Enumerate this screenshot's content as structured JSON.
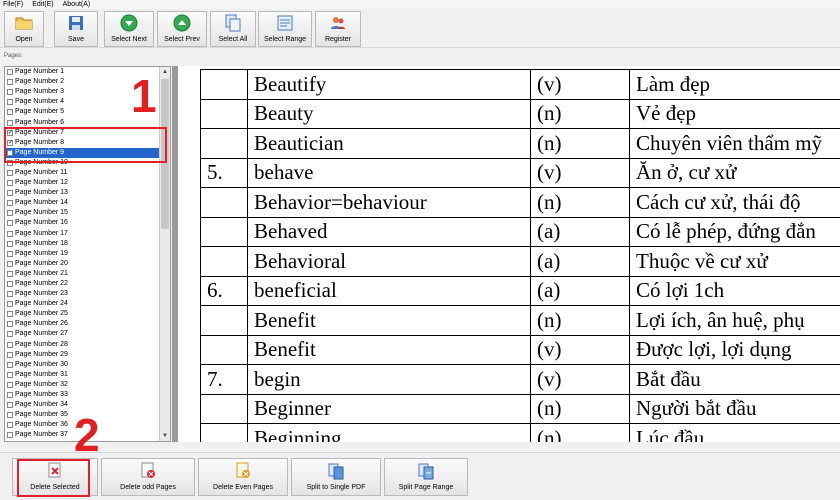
{
  "menu": {
    "file": "File(F)",
    "edit": "Edit(E)",
    "about": "About(A)"
  },
  "toolbar": {
    "open": "Open",
    "save": "Save",
    "select_next": "Select Next",
    "select_prev": "Select Prev",
    "select_all": "Select All",
    "select_range": "Select Range",
    "register": "Register"
  },
  "pages_label": "Pages:",
  "pages": [
    {
      "label": "Page Number 1",
      "checked": false,
      "selected": false
    },
    {
      "label": "Page Number 2",
      "checked": false,
      "selected": false
    },
    {
      "label": "Page Number 3",
      "checked": false,
      "selected": false
    },
    {
      "label": "Page Number 4",
      "checked": false,
      "selected": false
    },
    {
      "label": "Page Number 5",
      "checked": false,
      "selected": false
    },
    {
      "label": "Page Number 6",
      "checked": false,
      "selected": false
    },
    {
      "label": "Page Number 7",
      "checked": true,
      "selected": false
    },
    {
      "label": "Page Number 8",
      "checked": true,
      "selected": false
    },
    {
      "label": "Page Number 9",
      "checked": true,
      "selected": true
    },
    {
      "label": "Page Number 10",
      "checked": false,
      "selected": false
    },
    {
      "label": "Page Number 11",
      "checked": false,
      "selected": false
    },
    {
      "label": "Page Number 12",
      "checked": false,
      "selected": false
    },
    {
      "label": "Page Number 13",
      "checked": false,
      "selected": false
    },
    {
      "label": "Page Number 14",
      "checked": false,
      "selected": false
    },
    {
      "label": "Page Number 15",
      "checked": false,
      "selected": false
    },
    {
      "label": "Page Number 16",
      "checked": false,
      "selected": false
    },
    {
      "label": "Page Number 17",
      "checked": false,
      "selected": false
    },
    {
      "label": "Page Number 18",
      "checked": false,
      "selected": false
    },
    {
      "label": "Page Number 19",
      "checked": false,
      "selected": false
    },
    {
      "label": "Page Number 20",
      "checked": false,
      "selected": false
    },
    {
      "label": "Page Number 21",
      "checked": false,
      "selected": false
    },
    {
      "label": "Page Number 22",
      "checked": false,
      "selected": false
    },
    {
      "label": "Page Number 23",
      "checked": false,
      "selected": false
    },
    {
      "label": "Page Number 24",
      "checked": false,
      "selected": false
    },
    {
      "label": "Page Number 25",
      "checked": false,
      "selected": false
    },
    {
      "label": "Page Number 26",
      "checked": false,
      "selected": false
    },
    {
      "label": "Page Number 27",
      "checked": false,
      "selected": false
    },
    {
      "label": "Page Number 28",
      "checked": false,
      "selected": false
    },
    {
      "label": "Page Number 29",
      "checked": false,
      "selected": false
    },
    {
      "label": "Page Number 30",
      "checked": false,
      "selected": false
    },
    {
      "label": "Page Number 31",
      "checked": false,
      "selected": false
    },
    {
      "label": "Page Number 32",
      "checked": false,
      "selected": false
    },
    {
      "label": "Page Number 33",
      "checked": false,
      "selected": false
    },
    {
      "label": "Page Number 34",
      "checked": false,
      "selected": false
    },
    {
      "label": "Page Number 35",
      "checked": false,
      "selected": false
    },
    {
      "label": "Page Number 36",
      "checked": false,
      "selected": false
    },
    {
      "label": "Page Number 37",
      "checked": false,
      "selected": false
    }
  ],
  "callouts": {
    "one": "1",
    "two": "2"
  },
  "colors": {
    "selection": "#2266cc",
    "callout_red": "#e02020"
  },
  "vocab": [
    {
      "num": "",
      "word": "Beautify",
      "pos": "(v)",
      "meaning": "Làm đẹp"
    },
    {
      "num": "",
      "word": "Beauty",
      "pos": "(n)",
      "meaning": "Vẻ đẹp"
    },
    {
      "num": "",
      "word": "Beautician",
      "pos": "(n)",
      "meaning": "Chuyên viên  thẩm mỹ"
    },
    {
      "num": "5.",
      "word": "behave",
      "pos": "(v)",
      "meaning": "Ăn ở, cư xử"
    },
    {
      "num": "",
      "word": "Behavior=behaviour",
      "pos": "(n)",
      "meaning": "Cách cư xử, thái độ"
    },
    {
      "num": "",
      "word": "Behaved",
      "pos": "(a)",
      "meaning": "Có lễ phép, đứng đắn"
    },
    {
      "num": "",
      "word": "Behavioral",
      "pos": "(a)",
      "meaning": "Thuộc về cư xử"
    },
    {
      "num": "6.",
      "word": "beneficial",
      "pos": "(a)",
      "meaning": "Có lợi 1ch"
    },
    {
      "num": "",
      "word": "Benefit",
      "pos": "(n)",
      "meaning": "Lợi ích, ân huệ, phụ"
    },
    {
      "num": "",
      "word": "Benefit",
      "pos": "(v)",
      "meaning": "Được lợi, lợi dụng"
    },
    {
      "num": "7.",
      "word": "begin",
      "pos": "(v)",
      "meaning": "Bắt đầu"
    },
    {
      "num": "",
      "word": "Beginner",
      "pos": "(n)",
      "meaning": "Người bắt đầu"
    },
    {
      "num": "",
      "word": "Beginning",
      "pos": "(n)",
      "meaning": "Lúc đầu"
    }
  ],
  "bottom": {
    "delete_selected": "Delete Selected",
    "delete_odd": "Delete odd Pages",
    "delete_even": "Delete Even Pages",
    "split_single": "Split to Single PDF",
    "split_range": "Split Page Range"
  },
  "icons": {
    "open": "folder-icon",
    "save": "disk-icon",
    "select_next": "green-down-arrow-icon",
    "select_prev": "green-up-arrow-icon",
    "select_all": "pages-icon",
    "select_range": "range-icon",
    "register": "users-icon",
    "delete_selected": "delete-page-icon",
    "delete_odd": "delete-odd-icon",
    "delete_even": "delete-even-icon",
    "split_single": "split-icon",
    "split_range": "split-range-icon"
  }
}
